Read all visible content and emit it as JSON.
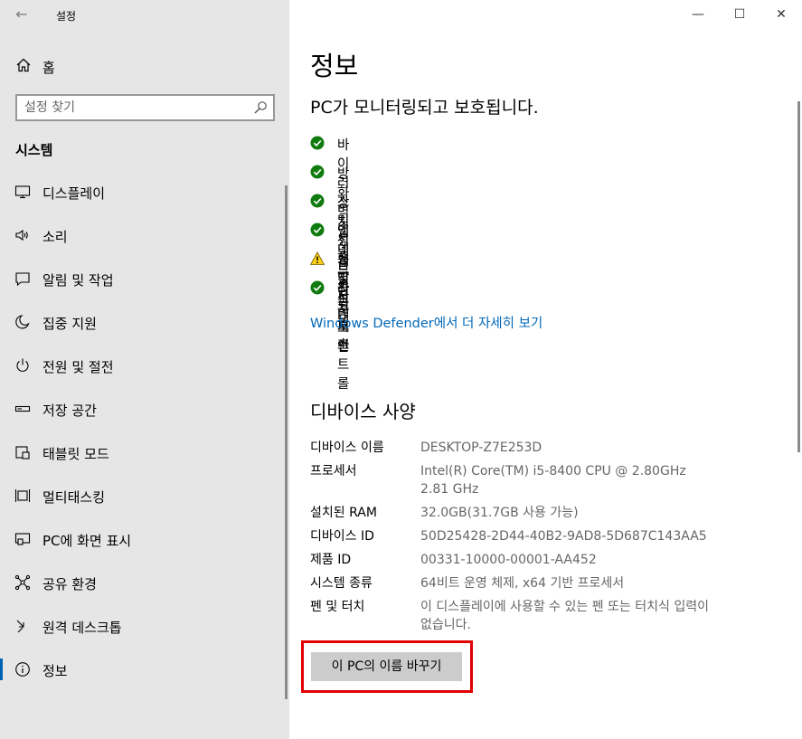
{
  "window": {
    "title": "설정",
    "back_icon": "arrow-left-icon",
    "controls": {
      "minimize": "—",
      "maximize": "☐",
      "close": "✕"
    }
  },
  "sidebar": {
    "home_label": "홈",
    "search_placeholder": "설정 찾기",
    "section_title": "시스템",
    "items": [
      {
        "label": "디스플레이",
        "icon": "display-icon"
      },
      {
        "label": "소리",
        "icon": "speaker-icon"
      },
      {
        "label": "알림 및 작업",
        "icon": "notification-icon"
      },
      {
        "label": "집중 지원",
        "icon": "moon-icon"
      },
      {
        "label": "전원 및 절전",
        "icon": "power-icon"
      },
      {
        "label": "저장 공간",
        "icon": "storage-icon"
      },
      {
        "label": "태블릿 모드",
        "icon": "tablet-icon"
      },
      {
        "label": "멀티태스킹",
        "icon": "multitasking-icon"
      },
      {
        "label": "PC에 화면 표시",
        "icon": "project-icon"
      },
      {
        "label": "공유 환경",
        "icon": "shared-experiences-icon"
      },
      {
        "label": "원격 데스크톱",
        "icon": "remote-desktop-icon"
      },
      {
        "label": "정보",
        "icon": "info-icon",
        "active": true
      }
    ]
  },
  "main": {
    "title": "정보",
    "protection_heading": "PC가 모니터링되고 보호됩니다.",
    "protection_items": [
      {
        "label": "바이러스 및 위협 방지",
        "status": "ok"
      },
      {
        "label": "방화벽 및 네트워크 보호",
        "status": "ok"
      },
      {
        "label": "장치 성능 및 상태",
        "status": "ok"
      },
      {
        "label": "앱 및 브라우저 컨트롤",
        "status": "ok"
      },
      {
        "label": "계정 보호",
        "status": "warning"
      },
      {
        "label": "장치 보안",
        "status": "ok"
      }
    ],
    "defender_link": "Windows Defender에서 더 자세히 보기",
    "specs_heading": "디바이스 사양",
    "specs": [
      {
        "key": "디바이스 이름",
        "value": "DESKTOP-Z7E253D"
      },
      {
        "key": "프로세서",
        "value": "Intel(R) Core(TM) i5-8400 CPU @ 2.80GHz 2.81 GHz"
      },
      {
        "key": "설치된 RAM",
        "value": "32.0GB(31.7GB 사용 가능)"
      },
      {
        "key": "디바이스 ID",
        "value": "50D25428-2D44-40B2-9AD8-5D687C143AA5"
      },
      {
        "key": "제품 ID",
        "value": "00331-10000-00001-AA452"
      },
      {
        "key": "시스템 종류",
        "value": "64비트 운영 체제, x64 기반 프로세서"
      },
      {
        "key": "펜 및 터치",
        "value": "이 디스플레이에 사용할 수 있는 펜 또는 터치식 입력이 없습니다."
      }
    ],
    "rename_button": "이 PC의 이름 바꾸기"
  },
  "colors": {
    "sidebar_bg": "#e6e6e6",
    "accent": "#0063b1",
    "link": "#0067b8",
    "ok_green": "#107c10",
    "warning_yellow": "#fcd116",
    "highlight_red": "#e00000",
    "button_bg": "#cccccc"
  }
}
